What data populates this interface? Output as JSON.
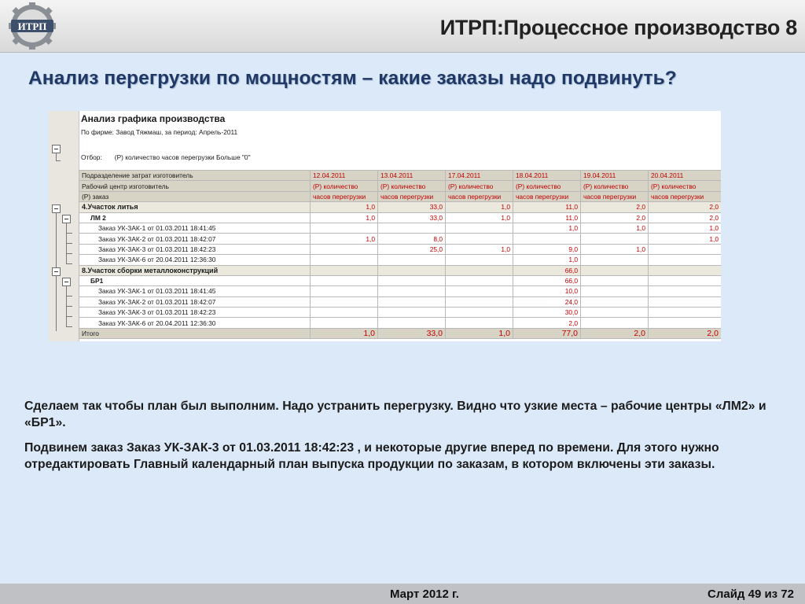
{
  "header": {
    "logo_text": "ИТРП",
    "title": "ИТРП:Процессное производство 8"
  },
  "slide": {
    "heading": "Анализ перегрузки по мощностям – какие заказы надо подвинуть?"
  },
  "report": {
    "title": "Анализ графика производства",
    "firm_line": "По фирме: Завод Тяжмаш, за период: Апрель-2011",
    "filter_label": "Отбор:",
    "filter_value": "(Р) количество часов перегрузки Больше \"0\"",
    "header_rows": [
      [
        "Подразделение затрат изготовитель",
        "12.04.2011",
        "13.04.2011",
        "17.04.2011",
        "18.04.2011",
        "19.04.2011",
        "20.04.2011"
      ],
      [
        "Рабочий центр изготовитель",
        "(Р) количество",
        "(Р) количество",
        "(Р) количество",
        "(Р) количество",
        "(Р) количество",
        "(Р) количество"
      ],
      [
        "(Р) заказ",
        "часов перегрузки",
        "часов перегрузки",
        "часов перегрузки",
        "часов перегрузки",
        "часов перегрузки",
        "часов перегрузки"
      ]
    ],
    "rows": [
      {
        "level": "grp",
        "name": "4.Участок литья",
        "values": [
          "1,0",
          "33,0",
          "1,0",
          "11,0",
          "2,0",
          "2,0"
        ]
      },
      {
        "level": "sub",
        "name": "ЛМ 2",
        "values": [
          "1,0",
          "33,0",
          "1,0",
          "11,0",
          "2,0",
          "2,0"
        ]
      },
      {
        "level": "ord",
        "name": "Заказ УК-ЗАК-1 от 01.03.2011 18:41:45",
        "values": [
          "",
          "",
          "",
          "1,0",
          "1,0",
          "1,0"
        ]
      },
      {
        "level": "ord",
        "name": "Заказ УК-ЗАК-2 от 01.03.2011 18:42:07",
        "values": [
          "1,0",
          "8,0",
          "",
          "",
          "",
          "1,0"
        ]
      },
      {
        "level": "ord",
        "name": "Заказ УК-ЗАК-3 от 01.03.2011 18:42:23",
        "values": [
          "",
          "25,0",
          "1,0",
          "9,0",
          "1,0",
          ""
        ]
      },
      {
        "level": "ord",
        "name": "Заказ УК-ЗАК-6 от 20.04.2011 12:36:30",
        "values": [
          "",
          "",
          "",
          "1,0",
          "",
          ""
        ]
      },
      {
        "level": "grp",
        "name": "8.Участок сборки металлоконструкций",
        "values": [
          "",
          "",
          "",
          "66,0",
          "",
          ""
        ]
      },
      {
        "level": "sub",
        "name": "БР1",
        "values": [
          "",
          "",
          "",
          "66,0",
          "",
          ""
        ]
      },
      {
        "level": "ord",
        "name": "Заказ УК-ЗАК-1 от 01.03.2011 18:41:45",
        "values": [
          "",
          "",
          "",
          "10,0",
          "",
          ""
        ]
      },
      {
        "level": "ord",
        "name": "Заказ УК-ЗАК-2 от 01.03.2011 18:42:07",
        "values": [
          "",
          "",
          "",
          "24,0",
          "",
          ""
        ]
      },
      {
        "level": "ord",
        "name": "Заказ УК-ЗАК-3 от 01.03.2011 18:42:23",
        "values": [
          "",
          "",
          "",
          "30,0",
          "",
          ""
        ]
      },
      {
        "level": "ord",
        "name": "Заказ УК-ЗАК-6 от 20.04.2011 12:36:30",
        "values": [
          "",
          "",
          "",
          "2,0",
          "",
          ""
        ]
      }
    ],
    "total": {
      "name": "Итого",
      "values": [
        "1,0",
        "33,0",
        "1,0",
        "77,0",
        "2,0",
        "2,0"
      ]
    }
  },
  "body": {
    "p1": "Сделаем так чтобы план был выполним. Надо устранить перегрузку. Видно что узкие места – рабочие центры «ЛМ2» и «БР1».",
    "p2": "Подвинем заказ Заказ УК-ЗАК-3 от 01.03.2011 18:42:23 , и некоторые другие  вперед по времени. Для этого нужно отредактировать Главный календарный план выпуска продукции по заказам, в котором включены эти заказы."
  },
  "footer": {
    "date": "Март 2012 г.",
    "slide": "Слайд 49 из 72"
  },
  "colors": {
    "accent_red": "#c00000",
    "heading_blue": "#203864",
    "background": "#dce9f8"
  }
}
